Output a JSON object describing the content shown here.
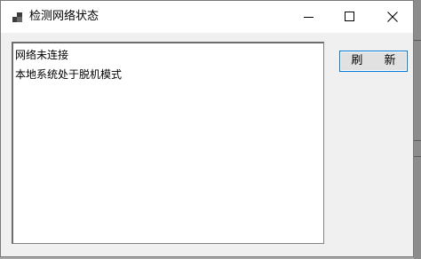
{
  "window": {
    "title": "检测网络状态",
    "controls": {
      "minimize": "minimize",
      "maximize": "maximize",
      "close": "close"
    }
  },
  "status_list": {
    "items": [
      "网络未连接",
      "本地系统处于脱机模式"
    ]
  },
  "actions": {
    "refresh_label": "刷 新"
  },
  "colors": {
    "button_border_focus": "#0078d7",
    "window_bg": "#f0f0f0"
  },
  "icons": {
    "app": "app-window-icon",
    "minimize": "minimize-icon",
    "maximize": "maximize-icon",
    "close": "close-icon"
  }
}
